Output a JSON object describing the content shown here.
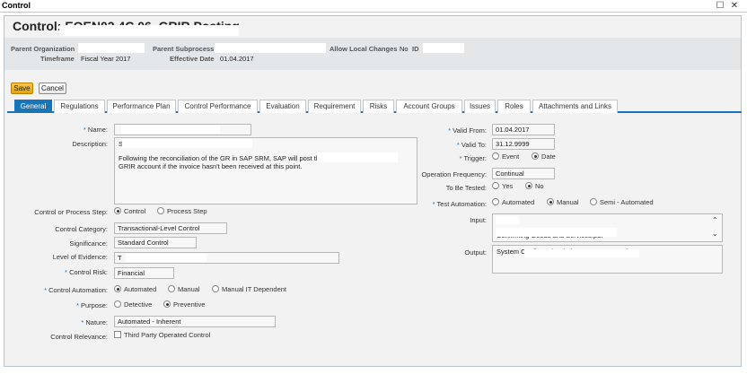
{
  "window": {
    "title": "Control"
  },
  "control": {
    "title_prefix": "Control:",
    "title_partial": "EOEN02.4C.06_GRIR Posting"
  },
  "header": {
    "parent_org_label": "Parent Organization",
    "parent_subprocess_label": "Parent Subprocess",
    "allow_local_changes_label": "Allow Local Changes",
    "allow_local_changes_value": "No",
    "id_label": "ID",
    "timeframe_label": "Timeframe",
    "timeframe_value": "Fiscal Year 2017",
    "effective_date_label": "Effective Date",
    "effective_date_value": "01.04.2017"
  },
  "toolbar": {
    "save_label": "Save",
    "cancel_label": "Cancel"
  },
  "tabs": [
    "General",
    "Regulations",
    "Performance Plan",
    "Control Performance",
    "Evaluation",
    "Requirement",
    "Risks",
    "Account Groups",
    "Issues",
    "Roles",
    "Attachments and Links"
  ],
  "form": {
    "name_label": "Name:",
    "description_label": "Description:",
    "description_line1": "Following the reconciliation of the GR in SAP SRM, SAP will post the",
    "description_line2": "GRIR account if the invoice hasn't been received at this point.",
    "control_or_process_step_label": "Control or Process Step:",
    "control_or_process_step_options": [
      "Control",
      "Process Step"
    ],
    "control_category_label": "Control Category:",
    "control_category_value": "Transactional-Level Control",
    "significance_label": "Significance:",
    "significance_value": "Standard Control",
    "level_of_evidence_label": "Level of Evidence:",
    "level_of_evidence_value": "T",
    "control_risk_label": "Control Risk:",
    "control_risk_value": "Financial",
    "control_automation_label": "Control Automation:",
    "control_automation_options": [
      "Automated",
      "Manual",
      "Manual IT Dependent"
    ],
    "purpose_label": "Purpose:",
    "purpose_options": [
      "Detective",
      "Preventive"
    ],
    "nature_label": "Nature:",
    "nature_value": "Automated - Inherent",
    "control_relevance_label": "Control Relevance:",
    "control_relevance_option": "Third Party Operated Control",
    "valid_from_label": "Valid From:",
    "valid_from_value": "01.04.2017",
    "valid_to_label": "Valid To:",
    "valid_to_value": "31.12.9999",
    "trigger_label": "Trigger:",
    "trigger_options": [
      "Event",
      "Date"
    ],
    "operation_frequency_label": "Operation Frequency:",
    "operation_frequency_value": "Continual",
    "to_be_tested_label": "To Be Tested:",
    "to_be_tested_options": [
      "Yes",
      "No"
    ],
    "test_automation_label": "Test Automation:",
    "test_automation_options": [
      "Automated",
      "Manual",
      "Semi - Automated"
    ],
    "input_label": "Input:",
    "input_value": "Confirming Goods and Services.pdf",
    "output_label": "Output:",
    "output_value": "System Configuration (Inherent SAP control)"
  }
}
